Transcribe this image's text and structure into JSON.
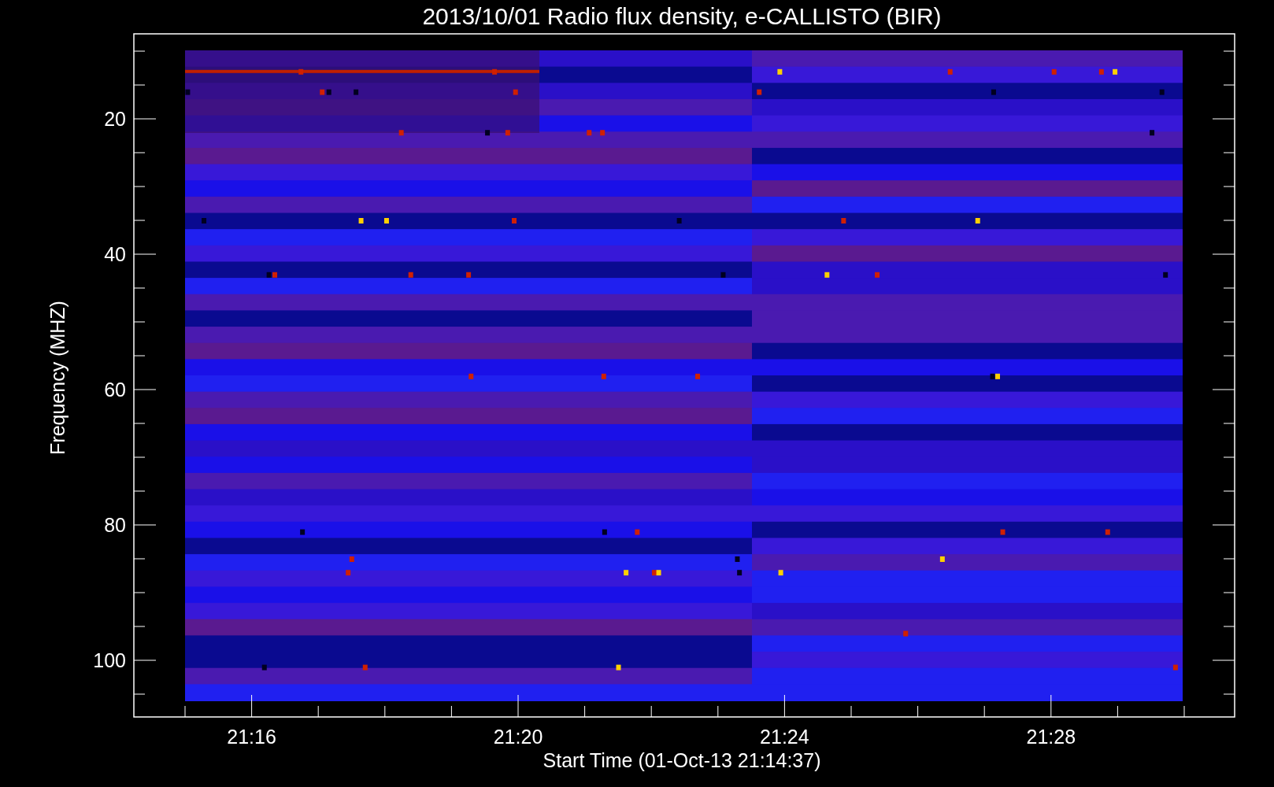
{
  "title": "2013/10/01  Radio flux density, e-CALLISTO (BIR)",
  "y_axis": {
    "label": "Frequency (MHZ)",
    "ticks": [
      "20",
      "40",
      "60",
      "80",
      "100"
    ]
  },
  "x_axis": {
    "label": "Start Time (01-Oct-13 21:14:37)",
    "ticks": [
      "21:16",
      "21:20",
      "21:24",
      "21:28"
    ]
  }
}
